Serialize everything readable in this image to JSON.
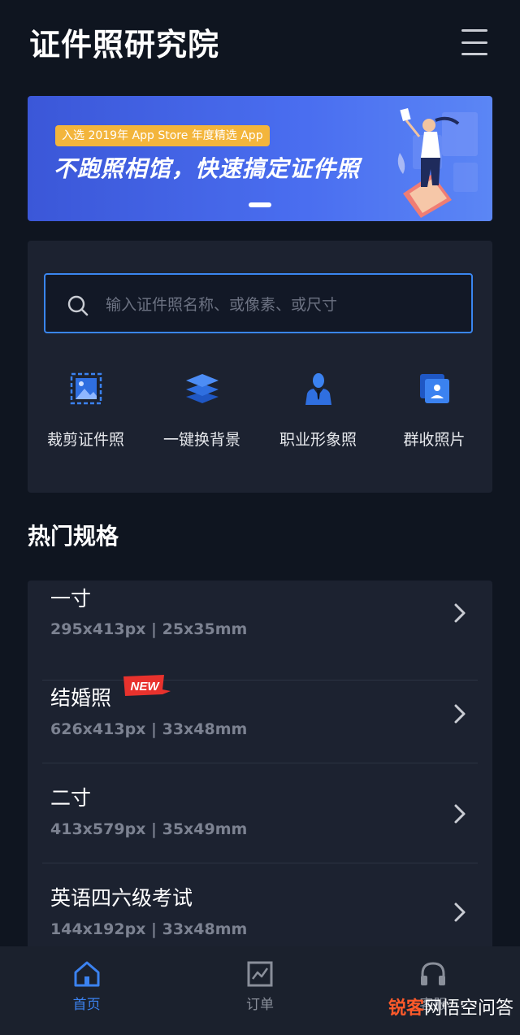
{
  "header": {
    "title": "证件照研究院",
    "menu_icon": "hamburger-menu-icon"
  },
  "banner": {
    "badge": "入选 2019年 App Store 年度精选 App",
    "headline": "不跑照相馆，快速搞定证件照",
    "colors": {
      "from": "#3b57d8",
      "to": "#5b86f5",
      "badge": "#f3b53c"
    }
  },
  "search": {
    "placeholder": "输入证件照名称、或像素、或尺寸",
    "value": ""
  },
  "tools": [
    {
      "label": "裁剪证件照",
      "icon": "crop-photo-icon"
    },
    {
      "label": "一键换背景",
      "icon": "layers-icon"
    },
    {
      "label": "职业形象照",
      "icon": "business-person-icon"
    },
    {
      "label": "群收照片",
      "icon": "photo-stack-icon"
    }
  ],
  "section": {
    "title": "热门规格"
  },
  "specs": [
    {
      "name": "一寸",
      "size": "295x413px | 25x35mm"
    },
    {
      "name": "结婚照",
      "size": "626x413px | 33x48mm",
      "badge": "NEW"
    },
    {
      "name": "二寸",
      "size": "413x579px | 35x49mm"
    },
    {
      "name": "英语四六级考试",
      "size": "144x192px | 33x48mm"
    }
  ],
  "tabbar": [
    {
      "label": "首页",
      "icon": "home-icon",
      "active": true
    },
    {
      "label": "订单",
      "icon": "order-chart-icon",
      "active": false
    },
    {
      "label": "客服",
      "icon": "headset-icon",
      "active": false
    }
  ],
  "watermark": {
    "part1": "锐客",
    "part2": "网",
    "part3": "悟空问答"
  },
  "colors": {
    "background": "#0f1520",
    "card": "#1c2230",
    "accent": "#3b82f0"
  }
}
